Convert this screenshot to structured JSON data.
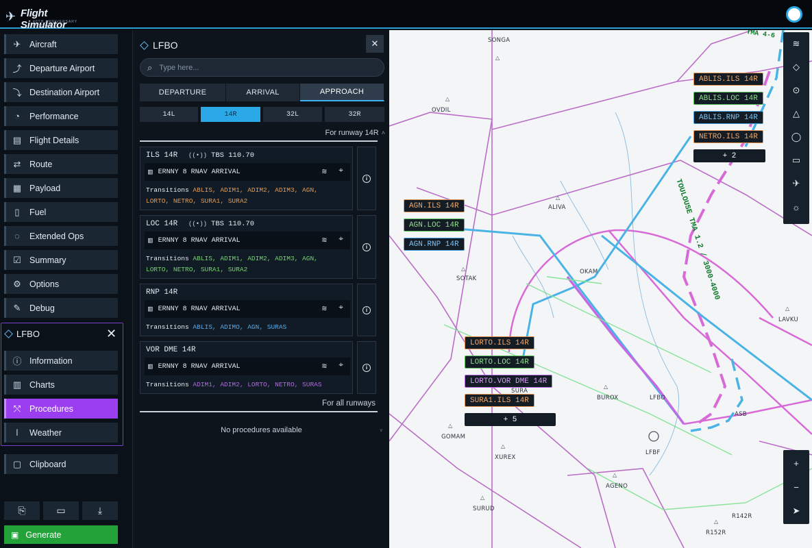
{
  "app": {
    "logo_text": "Flight Simulator",
    "logo_sub": "40TH ANNIVERSARY EDITION"
  },
  "sidebar": {
    "items": [
      {
        "label": "Aircraft",
        "icon": "airplane-icon",
        "glyph": "✈"
      },
      {
        "label": "Departure Airport",
        "icon": "departure-icon",
        "glyph": "🛫"
      },
      {
        "label": "Destination Airport",
        "icon": "arrival-icon",
        "glyph": "🛬"
      },
      {
        "label": "Performance",
        "icon": "gauge-icon",
        "glyph": "◔"
      },
      {
        "label": "Flight Details",
        "icon": "clipboard-icon",
        "glyph": "▤"
      },
      {
        "label": "Route",
        "icon": "route-icon",
        "glyph": "⇄"
      },
      {
        "label": "Payload",
        "icon": "payload-icon",
        "glyph": "▦"
      },
      {
        "label": "Fuel",
        "icon": "fuel-icon",
        "glyph": "⛽"
      },
      {
        "label": "Extended Ops",
        "icon": "dashed-circle-icon",
        "glyph": "◌"
      },
      {
        "label": "Summary",
        "icon": "checklist-icon",
        "glyph": "☑"
      },
      {
        "label": "Options",
        "icon": "wrench-icon",
        "glyph": "⚙"
      },
      {
        "label": "Debug",
        "icon": "bug-icon",
        "glyph": "✎"
      }
    ],
    "airport": {
      "code": "LFBO",
      "items": [
        {
          "label": "Information",
          "icon": "info-icon",
          "glyph": "ⓘ"
        },
        {
          "label": "Charts",
          "icon": "book-icon",
          "glyph": "▥"
        },
        {
          "label": "Procedures",
          "icon": "procedures-icon",
          "glyph": "⤲"
        },
        {
          "label": "Weather",
          "icon": "thermometer-icon",
          "glyph": "🌡"
        }
      ]
    },
    "clipboard": {
      "label": "Clipboard",
      "glyph": "📋"
    },
    "generate": {
      "label": "Generate",
      "glyph": "✎"
    }
  },
  "panel": {
    "title": "LFBO",
    "search_placeholder": "Type here...",
    "tabs": [
      "DEPARTURE",
      "ARRIVAL",
      "APPROACH"
    ],
    "active_tab": "APPROACH",
    "runways": [
      "14L",
      "14R",
      "32L",
      "32R"
    ],
    "active_runway": "14R",
    "for_runway": "For runway 14R",
    "procedures": [
      {
        "name": "ILS 14R",
        "freq": "TBS 110.70",
        "arrival": "ERNNY 8 RNAV ARRIVAL",
        "trans_label": "Transitions",
        "trans_list_1": "ABLIS, ADIM1, ADIM2, ADIM3, AGN,",
        "trans_list_2": "LORTO, NETRO, SURA1, SURA2",
        "color": "orange"
      },
      {
        "name": "LOC 14R",
        "freq": "TBS 110.70",
        "arrival": "ERNNY 8 RNAV ARRIVAL",
        "trans_label": "Transitions",
        "trans_list_1": "ABLIS, ADIM1, ADIM2, ADIM3, AGN,",
        "trans_list_2": "LORTO, NETRO, SURA1, SURA2",
        "color": "green"
      },
      {
        "name": "RNP 14R",
        "freq": "",
        "arrival": "ERNNY 8 RNAV ARRIVAL",
        "trans_label": "Transitions",
        "trans_list_1": "ABLIS, ADIMO, AGN, SURAS",
        "trans_list_2": "",
        "color": "blue"
      },
      {
        "name": "VOR DME 14R",
        "freq": "",
        "arrival": "ERNNY 8 RNAV ARRIVAL",
        "trans_label": "Transitions",
        "trans_list_1": "ADIM1, ADIM2, LORTO, NETRO, SURAS",
        "trans_list_2": "",
        "color": "purple"
      }
    ],
    "for_all_runways": "For all runways",
    "no_procedures": "No procedures available"
  },
  "map": {
    "tma_label": "TOULOUSE TMA 1.2 / 3000-4000",
    "tma_top": "TMA 4-6",
    "tags_top_right": [
      {
        "label": "ABLIS.ILS 14R",
        "color": "orange"
      },
      {
        "label": "ABLIS.LOC 14R",
        "color": "green"
      },
      {
        "label": "ABLIS.RNP 14R",
        "color": "blue"
      },
      {
        "label": "NETRO.ILS 14R",
        "color": "orange"
      },
      {
        "label": "+ 2",
        "color": "more"
      }
    ],
    "tags_left": [
      {
        "label": "AGN.ILS 14R",
        "color": "orange"
      },
      {
        "label": "AGN.LOC 14R",
        "color": "green"
      },
      {
        "label": "AGN.RNP 14R",
        "color": "blue"
      }
    ],
    "tags_bottom": [
      {
        "label": "LORTO.ILS 14R",
        "color": "orange"
      },
      {
        "label": "LORTO.LOC 14R",
        "color": "green"
      },
      {
        "label": "LORTO.VOR DME 14R",
        "color": "purple"
      },
      {
        "label": "SURA1.ILS 14R",
        "color": "orange"
      },
      {
        "label": "+ 5",
        "color": "more"
      }
    ],
    "places": [
      "SONGA",
      "OVDIL",
      "ALIVA",
      "SOTAK",
      "OKAM",
      "LAVKU",
      "BUROX",
      "LFBF",
      "GOMAM",
      "XUREX",
      "AGENO",
      "SURUD",
      "R142R",
      "R152R",
      "ASB",
      "SURA",
      "LFBO"
    ],
    "tools": [
      "layers-icon",
      "diamond-icon",
      "circle-dot-icon",
      "triangle-icon",
      "circle-icon",
      "runway-icon",
      "plane-icon",
      "sun-icon"
    ],
    "zoom": [
      "+",
      "−",
      "➤"
    ]
  },
  "colors": {
    "accent": "#2aa8e8",
    "active_nav": "#9b3ef0",
    "generate": "#23a23a"
  }
}
